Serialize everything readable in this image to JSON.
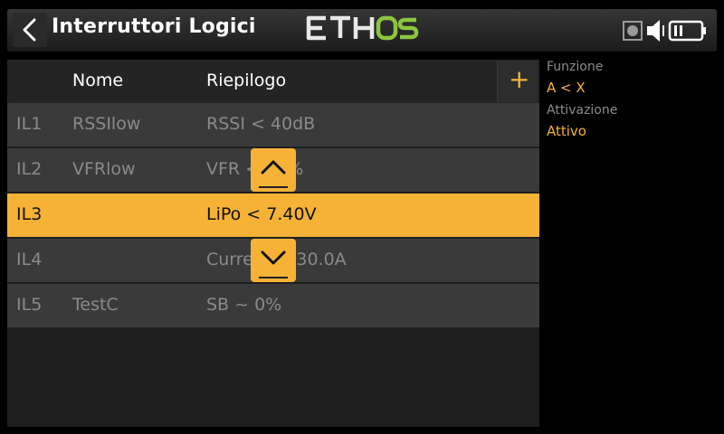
{
  "header": {
    "title": "Interruttori Logici",
    "logo_text": "ETHOS",
    "back_icon": "chevron-left-icon",
    "status_icons": [
      "sd-card-icon",
      "speaker-icon",
      "battery-icon"
    ]
  },
  "table": {
    "columns": [
      "Nome",
      "Riepilogo"
    ],
    "add_label": "+",
    "rows": [
      {
        "id": "IL1",
        "name": "RSSIlow",
        "summary": "RSSI < 40dB"
      },
      {
        "id": "IL2",
        "name": "VFRlow",
        "summary": "VFR < 50%"
      },
      {
        "id": "IL3",
        "name": "",
        "summary": "LiPo < 7.40V"
      },
      {
        "id": "IL4",
        "name": "",
        "summary": "Current > 30.0A"
      },
      {
        "id": "IL5",
        "name": "TestC",
        "summary": "SB ~ 0%"
      }
    ],
    "selected_row": "IL3"
  },
  "side_info": {
    "function_label": "Funzione",
    "function_value": "A < X",
    "activation_label": "Attivazione",
    "activation_value": "Attivo"
  },
  "colors": {
    "accent": "#f5b237",
    "row_bg": "#3a3a3a",
    "panel_bg": "#1f1f1f"
  }
}
